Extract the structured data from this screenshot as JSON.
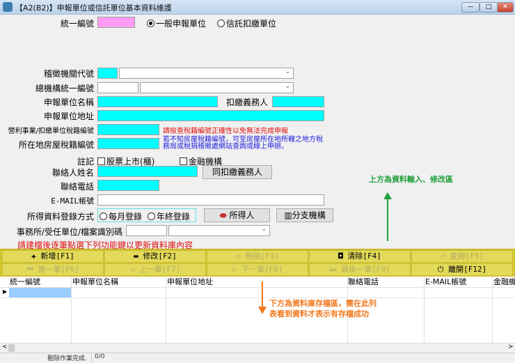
{
  "window": {
    "title": "【A2(B2)】申報單位或信託單位基本資料維護",
    "min": "—",
    "max": "□",
    "close": "✕"
  },
  "form": {
    "ubn_label": "統一編號",
    "unit_type": {
      "options": [
        "一般申報單位",
        "信託扣繳單位"
      ],
      "selected": "一般申報單位"
    },
    "agency_code_label": "稽徵機關代號",
    "hq_ubn_label": "總機構統一編號",
    "unit_name_label": "申報單位名稱",
    "withholder_label": "扣繳義務人",
    "unit_address_label": "申報單位地址",
    "tax_id_label": "營利事業/扣繳單位稅籍編號",
    "tax_id_warning": "請檢查稅籍編號正確性以免無法完成申報",
    "house_tax_label": "所在地房屋稅籍編號",
    "house_tax_hint_1": "若不知房屋稅籍編號，可至房屋所在地所轄之地方稅",
    "house_tax_hint_2": "務局或稅捐稽徵處網站查詢或線上申辦。",
    "note_label": "註記",
    "note_listed": "股票上市(櫃)",
    "note_financial": "金融機構",
    "contact_name_label": "聯絡人姓名",
    "same_as_withholder_button": "同扣繳義務人",
    "contact_phone_label": "聯絡電話",
    "email_label": "E-MAIL帳號",
    "entry_method_label": "所得資料登錄方式",
    "entry_method_options": [
      "每月登錄",
      "年終登錄"
    ],
    "income_person_button": "所得人",
    "branch_button": "分支機構",
    "office_label": "事務所/受任單位/檔案識別碼",
    "update_hint": "請建檔後逐筆點選下列功能鍵以更新資料庫內容"
  },
  "toolbar": {
    "row1": [
      {
        "label": "新增[F1]",
        "icon": "✚",
        "enabled": true
      },
      {
        "label": "修改[F2]",
        "icon": "▬",
        "enabled": true
      },
      {
        "label": "刪除[F3]",
        "icon": "▭",
        "enabled": false
      },
      {
        "label": "清除[F4]",
        "icon": "◘",
        "enabled": true
      },
      {
        "label": "查詢[F5]",
        "icon": "⌕",
        "enabled": false
      }
    ],
    "row2": [
      {
        "label": "第一筆[F6]",
        "icon": "⏮",
        "enabled": false
      },
      {
        "label": "上一筆[F7]",
        "icon": "◁",
        "enabled": false
      },
      {
        "label": "下一筆[F8]",
        "icon": "▷",
        "enabled": false
      },
      {
        "label": "最後一筆[F9]",
        "icon": "⏭",
        "enabled": false
      },
      {
        "label": "離開[F12]",
        "icon": "⏻",
        "enabled": true
      }
    ]
  },
  "grid": {
    "columns": [
      "統一編號",
      "申報單位名稱",
      "申報單位地址",
      "聯絡電話",
      "E-MAIL帳號",
      "金融機"
    ]
  },
  "status": {
    "message": "刪除作業完成.",
    "count": "0/0"
  },
  "annotations": {
    "top": "上方為資料輸入、修改區",
    "bottom_1": "下方為資料庫存檔區，需在此列",
    "bottom_2": "表看到資料才表示有存檔成功",
    "green": "#22a03c",
    "orange": "#f07a20"
  }
}
